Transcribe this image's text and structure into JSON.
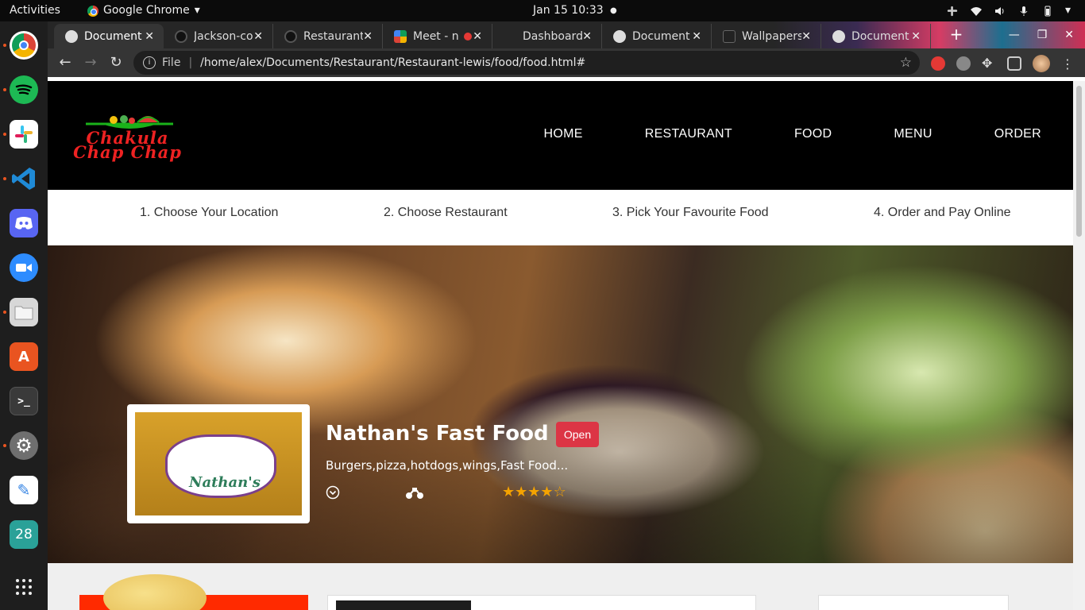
{
  "system": {
    "activities": "Activities",
    "app_name": "Google Chrome",
    "clock": "Jan 15  10:33"
  },
  "dock": {
    "items": [
      {
        "name": "chrome",
        "color": "#ffffff"
      },
      {
        "name": "spotify",
        "color": "#1db954"
      },
      {
        "name": "slack",
        "color": "#ffffff"
      },
      {
        "name": "vscode",
        "color": "#0e7ad3"
      },
      {
        "name": "discord",
        "color": "#5865f2"
      },
      {
        "name": "zoom",
        "color": "#2d8cff"
      },
      {
        "name": "files",
        "color": "#c9c9c9"
      },
      {
        "name": "software",
        "color": "#e95420"
      },
      {
        "name": "terminal",
        "color": "#3a3a3a"
      },
      {
        "name": "settings",
        "color": "#7a7a7a"
      },
      {
        "name": "text-editor",
        "color": "#ffffff"
      },
      {
        "name": "calendar",
        "color": "#2aa198",
        "label": "28"
      },
      {
        "name": "show-apps",
        "color": "transparent"
      }
    ]
  },
  "browser": {
    "tabs": [
      {
        "title": "Document",
        "active": true
      },
      {
        "title": "Jackson-co",
        "active": false
      },
      {
        "title": "Restaurant",
        "active": false
      },
      {
        "title": "Meet - n",
        "active": false
      },
      {
        "title": "Dashboard",
        "active": false
      },
      {
        "title": "Document",
        "active": false
      },
      {
        "title": "Wallpapers",
        "active": false
      },
      {
        "title": "Document",
        "active": false
      }
    ],
    "address": {
      "scheme_label": "File",
      "url": "/home/alex/Documents/Restaurant/Restaurant-lewis/food/food.html#"
    }
  },
  "site": {
    "logo": {
      "line1": "Chakula",
      "line2": "Chap Chap"
    },
    "nav": [
      "HOME",
      "RESTAURANT",
      "FOOD",
      "MENU",
      "ORDER"
    ],
    "steps": [
      "1. Choose Your Location",
      "2. Choose Restaurant",
      "3. Pick Your Favourite Food",
      "4. Order and Pay Online"
    ],
    "restaurant": {
      "name": "Nathan's Fast Food",
      "status": "Open",
      "cuisine": "Burgers,pizza,hotdogs,wings,Fast Food...",
      "rating": 4,
      "rating_max": 5,
      "thumb_sign_text": "Nathan's"
    },
    "colors": {
      "header_bg": "#000000",
      "logo_red": "#e22222",
      "badge_red": "#dc3545",
      "star_gold": "#f5a300"
    }
  }
}
